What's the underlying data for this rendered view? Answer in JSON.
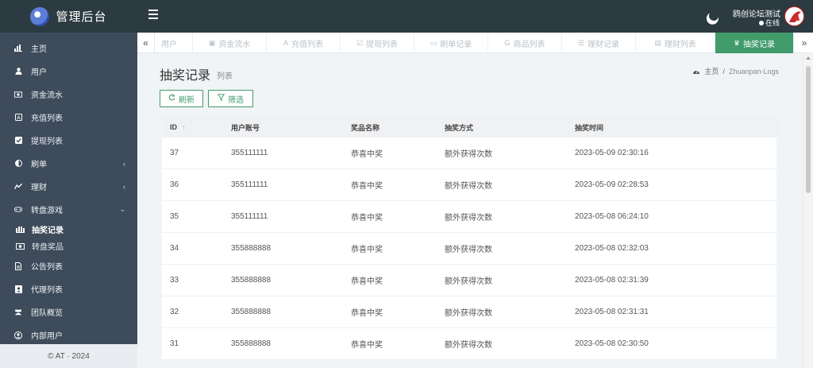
{
  "app": {
    "title": "管理后台"
  },
  "sidebar": {
    "items": [
      {
        "label": "主页",
        "icon": "bar-chart-icon"
      },
      {
        "label": "用户",
        "icon": "user-icon"
      },
      {
        "label": "资金流水",
        "icon": "money-icon"
      },
      {
        "label": "充值列表",
        "icon": "font-icon"
      },
      {
        "label": "提现列表",
        "icon": "check-square-icon"
      },
      {
        "label": "刷单",
        "icon": "half-circle-icon",
        "arrow": "‹"
      },
      {
        "label": "理财",
        "icon": "chart-icon",
        "arrow": "‹"
      },
      {
        "label": "转盘游戏",
        "icon": "gamepad-icon",
        "arrow": "⌄"
      }
    ],
    "sub_items": [
      {
        "label": "抽奖记录",
        "icon": "lottery-icon",
        "active": true
      },
      {
        "label": "转盘奖品",
        "icon": "money-icon",
        "active": false
      }
    ],
    "items_after": [
      {
        "label": "公告列表",
        "icon": "file-icon"
      },
      {
        "label": "代理列表",
        "icon": "user-badge-icon"
      },
      {
        "label": "团队概览",
        "icon": "users-icon"
      },
      {
        "label": "内部用户",
        "icon": "user-circle-icon"
      }
    ],
    "footer": "© AT · 2024"
  },
  "topbar": {
    "user_name": "鸥创论坛测试",
    "status": "在线"
  },
  "tabs": [
    {
      "label": "用户",
      "icon": ""
    },
    {
      "label": "资金流水",
      "icon": "▣"
    },
    {
      "label": "充值列表",
      "icon": "A"
    },
    {
      "label": "提现列表",
      "icon": "☑"
    },
    {
      "label": "刷单记录",
      "icon": "▭"
    },
    {
      "label": "商品列表",
      "icon": "G"
    },
    {
      "label": "理财记录",
      "icon": "☰"
    },
    {
      "label": "理财列表",
      "icon": "▤"
    },
    {
      "label": "抽奖记录",
      "icon": "♛"
    }
  ],
  "page": {
    "title": "抽奖记录",
    "subtitle": "列表",
    "breadcrumb_home": "主页",
    "breadcrumb_current": "Zhuanpan-Logs",
    "refresh_label": "刷新",
    "filter_label": "筛选"
  },
  "table": {
    "columns": [
      "ID",
      "用户账号",
      "奖品名称",
      "抽奖方式",
      "抽奖时间"
    ],
    "rows": [
      [
        "37",
        "355111111",
        "恭喜中奖",
        "额外获得次数",
        "2023-05-09 02:30:16"
      ],
      [
        "36",
        "355111111",
        "恭喜中奖",
        "额外获得次数",
        "2023-05-09 02:28:53"
      ],
      [
        "35",
        "355111111",
        "恭喜中奖",
        "额外获得次数",
        "2023-05-08 06:24:10"
      ],
      [
        "34",
        "355888888",
        "恭喜中奖",
        "额外获得次数",
        "2023-05-08 02:32:03"
      ],
      [
        "33",
        "355888888",
        "恭喜中奖",
        "额外获得次数",
        "2023-05-08 02:31:39"
      ],
      [
        "32",
        "355888888",
        "恭喜中奖",
        "额外获得次数",
        "2023-05-08 02:31:31"
      ],
      [
        "31",
        "355888888",
        "恭喜中奖",
        "额外获得次数",
        "2023-05-08 02:30:50"
      ]
    ]
  },
  "colors": {
    "accent": "#419b6b",
    "sidebar": "#3e4b5b",
    "topbar": "#2c3b41"
  }
}
